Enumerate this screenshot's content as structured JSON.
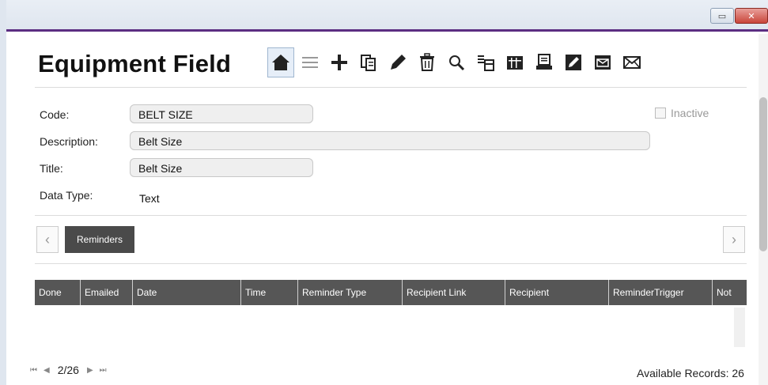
{
  "window": {
    "restore_glyph": "▭",
    "close_glyph": "✕"
  },
  "header": {
    "title": "Equipment Field"
  },
  "toolbar": {
    "icons": [
      "home-icon",
      "list-icon",
      "add-icon",
      "copy-icon",
      "edit-pencil-icon",
      "delete-trash-icon",
      "search-icon",
      "import-icon",
      "columns-icon",
      "print-icon",
      "edit-box-icon",
      "mail-box-icon",
      "mail-icon"
    ]
  },
  "form": {
    "code_label": "Code:",
    "code_value": "BELT SIZE",
    "description_label": "Description:",
    "description_value": "Belt Size",
    "title_label": "Title:",
    "title_value": "Belt Size",
    "data_type_label": "Data Type:",
    "data_type_value": "Text",
    "inactive_label": "Inactive"
  },
  "tabs": {
    "prev_glyph": "‹",
    "next_glyph": "›",
    "items": [
      {
        "label": "Reminders"
      }
    ]
  },
  "grid": {
    "columns": [
      "Done",
      "Emailed",
      "Date",
      "Time",
      "Reminder Type",
      "Recipient Link",
      "Recipient",
      "ReminderTrigger",
      "Not"
    ]
  },
  "footer": {
    "first_glyph": "⏮",
    "prev_glyph": "◀",
    "position": "2/26",
    "next_glyph": "▶",
    "last_glyph": "⏭",
    "available_label": "Available Records:",
    "available_count": "26"
  },
  "colors": {
    "accent": "#5b2d82",
    "grid_header": "#565656",
    "tab_active": "#4a4a4a"
  }
}
